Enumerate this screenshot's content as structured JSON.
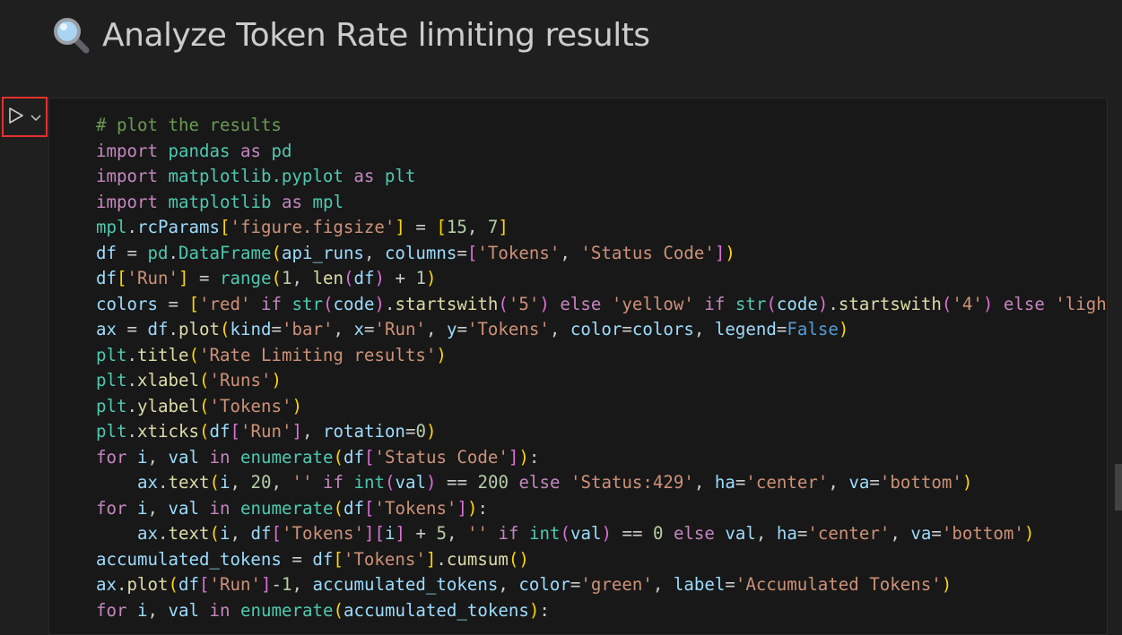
{
  "heading": {
    "icon": "magnifier-icon",
    "text": "Analyze Token Rate limiting results"
  },
  "cell_toolbar": {
    "run_icon": "run-triangle-icon",
    "menu_icon": "chevron-down-icon",
    "highlight_color": "#e5312d"
  },
  "theme": {
    "background": "#1f1f1f",
    "cell_background": "#181818",
    "comment": "#6a9955",
    "keyword": "#c586c0",
    "module": "#4ec9b0",
    "string": "#ce9178",
    "number": "#b5cea8",
    "function": "#dcdcaa",
    "variable": "#9cdcfe",
    "constant": "#569cd6",
    "bracket_1": "#ffd700",
    "bracket_2": "#da70d6",
    "bracket_3": "#179fff"
  },
  "code_lines": [
    {
      "indent": 0,
      "tokens": [
        [
          "cm",
          "# plot the results"
        ]
      ]
    },
    {
      "indent": 0,
      "tokens": [
        [
          "kw",
          "import"
        ],
        [
          "pl",
          " "
        ],
        [
          "md",
          "pandas"
        ],
        [
          "pl",
          " "
        ],
        [
          "kw",
          "as"
        ],
        [
          "pl",
          " "
        ],
        [
          "md",
          "pd"
        ]
      ]
    },
    {
      "indent": 0,
      "tokens": [
        [
          "kw",
          "import"
        ],
        [
          "pl",
          " "
        ],
        [
          "md",
          "matplotlib.pyplot"
        ],
        [
          "pl",
          " "
        ],
        [
          "kw",
          "as"
        ],
        [
          "pl",
          " "
        ],
        [
          "md",
          "plt"
        ]
      ]
    },
    {
      "indent": 0,
      "tokens": [
        [
          "kw",
          "import"
        ],
        [
          "pl",
          " "
        ],
        [
          "md",
          "matplotlib"
        ],
        [
          "pl",
          " "
        ],
        [
          "kw",
          "as"
        ],
        [
          "pl",
          " "
        ],
        [
          "md",
          "mpl"
        ]
      ]
    },
    {
      "indent": 0,
      "tokens": [
        [
          "md",
          "mpl"
        ],
        [
          "pl",
          "."
        ],
        [
          "vr",
          "rcParams"
        ],
        [
          "b1",
          "["
        ],
        [
          "st",
          "'figure.figsize'"
        ],
        [
          "b1",
          "]"
        ],
        [
          "pl",
          " = "
        ],
        [
          "b1",
          "["
        ],
        [
          "nm",
          "15"
        ],
        [
          "pl",
          ", "
        ],
        [
          "nm",
          "7"
        ],
        [
          "b1",
          "]"
        ]
      ]
    },
    {
      "indent": 0,
      "tokens": [
        [
          "vr",
          "df"
        ],
        [
          "pl",
          " = "
        ],
        [
          "md",
          "pd"
        ],
        [
          "pl",
          "."
        ],
        [
          "md",
          "DataFrame"
        ],
        [
          "b1",
          "("
        ],
        [
          "vr",
          "api_runs"
        ],
        [
          "pl",
          ", "
        ],
        [
          "vr",
          "columns"
        ],
        [
          "pl",
          "="
        ],
        [
          "b2",
          "["
        ],
        [
          "st",
          "'Tokens'"
        ],
        [
          "pl",
          ", "
        ],
        [
          "st",
          "'Status Code'"
        ],
        [
          "b2",
          "]"
        ],
        [
          "b1",
          ")"
        ]
      ]
    },
    {
      "indent": 0,
      "tokens": [
        [
          "vr",
          "df"
        ],
        [
          "b1",
          "["
        ],
        [
          "st",
          "'Run'"
        ],
        [
          "b1",
          "]"
        ],
        [
          "pl",
          " = "
        ],
        [
          "md",
          "range"
        ],
        [
          "b1",
          "("
        ],
        [
          "nm",
          "1"
        ],
        [
          "pl",
          ", "
        ],
        [
          "fn",
          "len"
        ],
        [
          "b2",
          "("
        ],
        [
          "vr",
          "df"
        ],
        [
          "b2",
          ")"
        ],
        [
          "pl",
          " + "
        ],
        [
          "nm",
          "1"
        ],
        [
          "b1",
          ")"
        ]
      ]
    },
    {
      "indent": 0,
      "tokens": [
        [
          "vr",
          "colors"
        ],
        [
          "pl",
          " = "
        ],
        [
          "b1",
          "["
        ],
        [
          "st",
          "'red'"
        ],
        [
          "pl",
          " "
        ],
        [
          "kw",
          "if"
        ],
        [
          "pl",
          " "
        ],
        [
          "md",
          "str"
        ],
        [
          "b2",
          "("
        ],
        [
          "vr",
          "code"
        ],
        [
          "b2",
          ")"
        ],
        [
          "pl",
          "."
        ],
        [
          "fn",
          "startswith"
        ],
        [
          "b2",
          "("
        ],
        [
          "st",
          "'5'"
        ],
        [
          "b2",
          ")"
        ],
        [
          "pl",
          " "
        ],
        [
          "kw",
          "else"
        ],
        [
          "pl",
          " "
        ],
        [
          "st",
          "'yellow'"
        ],
        [
          "pl",
          " "
        ],
        [
          "kw",
          "if"
        ],
        [
          "pl",
          " "
        ],
        [
          "md",
          "str"
        ],
        [
          "b2",
          "("
        ],
        [
          "vr",
          "code"
        ],
        [
          "b2",
          ")"
        ],
        [
          "pl",
          "."
        ],
        [
          "fn",
          "startswith"
        ],
        [
          "b2",
          "("
        ],
        [
          "st",
          "'4'"
        ],
        [
          "b2",
          ")"
        ],
        [
          "pl",
          " "
        ],
        [
          "kw",
          "else"
        ],
        [
          "pl",
          " "
        ],
        [
          "st",
          "'ligh"
        ]
      ]
    },
    {
      "indent": 0,
      "tokens": [
        [
          "vr",
          "ax"
        ],
        [
          "pl",
          " = "
        ],
        [
          "vr",
          "df"
        ],
        [
          "pl",
          "."
        ],
        [
          "fn",
          "plot"
        ],
        [
          "b1",
          "("
        ],
        [
          "vr",
          "kind"
        ],
        [
          "pl",
          "="
        ],
        [
          "st",
          "'bar'"
        ],
        [
          "pl",
          ", "
        ],
        [
          "vr",
          "x"
        ],
        [
          "pl",
          "="
        ],
        [
          "st",
          "'Run'"
        ],
        [
          "pl",
          ", "
        ],
        [
          "vr",
          "y"
        ],
        [
          "pl",
          "="
        ],
        [
          "st",
          "'Tokens'"
        ],
        [
          "pl",
          ", "
        ],
        [
          "vr",
          "color"
        ],
        [
          "pl",
          "="
        ],
        [
          "vr",
          "colors"
        ],
        [
          "pl",
          ", "
        ],
        [
          "vr",
          "legend"
        ],
        [
          "pl",
          "="
        ],
        [
          "bl",
          "False"
        ],
        [
          "b1",
          ")"
        ]
      ]
    },
    {
      "indent": 0,
      "tokens": [
        [
          "md",
          "plt"
        ],
        [
          "pl",
          "."
        ],
        [
          "fn",
          "title"
        ],
        [
          "b1",
          "("
        ],
        [
          "st",
          "'Rate Limiting results'"
        ],
        [
          "b1",
          ")"
        ]
      ]
    },
    {
      "indent": 0,
      "tokens": [
        [
          "md",
          "plt"
        ],
        [
          "pl",
          "."
        ],
        [
          "fn",
          "xlabel"
        ],
        [
          "b1",
          "("
        ],
        [
          "st",
          "'Runs'"
        ],
        [
          "b1",
          ")"
        ]
      ]
    },
    {
      "indent": 0,
      "tokens": [
        [
          "md",
          "plt"
        ],
        [
          "pl",
          "."
        ],
        [
          "fn",
          "ylabel"
        ],
        [
          "b1",
          "("
        ],
        [
          "st",
          "'Tokens'"
        ],
        [
          "b1",
          ")"
        ]
      ]
    },
    {
      "indent": 0,
      "tokens": [
        [
          "md",
          "plt"
        ],
        [
          "pl",
          "."
        ],
        [
          "fn",
          "xticks"
        ],
        [
          "b1",
          "("
        ],
        [
          "vr",
          "df"
        ],
        [
          "b2",
          "["
        ],
        [
          "st",
          "'Run'"
        ],
        [
          "b2",
          "]"
        ],
        [
          "pl",
          ", "
        ],
        [
          "vr",
          "rotation"
        ],
        [
          "pl",
          "="
        ],
        [
          "nm",
          "0"
        ],
        [
          "b1",
          ")"
        ]
      ]
    },
    {
      "indent": 0,
      "tokens": [
        [
          "kw",
          "for"
        ],
        [
          "pl",
          " "
        ],
        [
          "vr",
          "i"
        ],
        [
          "pl",
          ", "
        ],
        [
          "vr",
          "val"
        ],
        [
          "pl",
          " "
        ],
        [
          "kw",
          "in"
        ],
        [
          "pl",
          " "
        ],
        [
          "md",
          "enumerate"
        ],
        [
          "b1",
          "("
        ],
        [
          "vr",
          "df"
        ],
        [
          "b2",
          "["
        ],
        [
          "st",
          "'Status Code'"
        ],
        [
          "b2",
          "]"
        ],
        [
          "b1",
          ")"
        ],
        [
          "pl",
          ":"
        ]
      ]
    },
    {
      "indent": 1,
      "tokens": [
        [
          "vr",
          "ax"
        ],
        [
          "pl",
          "."
        ],
        [
          "fn",
          "text"
        ],
        [
          "b1",
          "("
        ],
        [
          "vr",
          "i"
        ],
        [
          "pl",
          ", "
        ],
        [
          "nm",
          "20"
        ],
        [
          "pl",
          ", "
        ],
        [
          "st",
          "''"
        ],
        [
          "pl",
          " "
        ],
        [
          "kw",
          "if"
        ],
        [
          "pl",
          " "
        ],
        [
          "md",
          "int"
        ],
        [
          "b2",
          "("
        ],
        [
          "vr",
          "val"
        ],
        [
          "b2",
          ")"
        ],
        [
          "pl",
          " == "
        ],
        [
          "nm",
          "200"
        ],
        [
          "pl",
          " "
        ],
        [
          "kw",
          "else"
        ],
        [
          "pl",
          " "
        ],
        [
          "st",
          "'Status:429'"
        ],
        [
          "pl",
          ", "
        ],
        [
          "vr",
          "ha"
        ],
        [
          "pl",
          "="
        ],
        [
          "st",
          "'center'"
        ],
        [
          "pl",
          ", "
        ],
        [
          "vr",
          "va"
        ],
        [
          "pl",
          "="
        ],
        [
          "st",
          "'bottom'"
        ],
        [
          "b1",
          ")"
        ]
      ]
    },
    {
      "indent": 0,
      "tokens": [
        [
          "kw",
          "for"
        ],
        [
          "pl",
          " "
        ],
        [
          "vr",
          "i"
        ],
        [
          "pl",
          ", "
        ],
        [
          "vr",
          "val"
        ],
        [
          "pl",
          " "
        ],
        [
          "kw",
          "in"
        ],
        [
          "pl",
          " "
        ],
        [
          "md",
          "enumerate"
        ],
        [
          "b1",
          "("
        ],
        [
          "vr",
          "df"
        ],
        [
          "b2",
          "["
        ],
        [
          "st",
          "'Tokens'"
        ],
        [
          "b2",
          "]"
        ],
        [
          "b1",
          ")"
        ],
        [
          "pl",
          ":"
        ]
      ]
    },
    {
      "indent": 1,
      "tokens": [
        [
          "vr",
          "ax"
        ],
        [
          "pl",
          "."
        ],
        [
          "fn",
          "text"
        ],
        [
          "b1",
          "("
        ],
        [
          "vr",
          "i"
        ],
        [
          "pl",
          ", "
        ],
        [
          "vr",
          "df"
        ],
        [
          "b2",
          "["
        ],
        [
          "st",
          "'Tokens'"
        ],
        [
          "b2",
          "]"
        ],
        [
          "b2",
          "["
        ],
        [
          "vr",
          "i"
        ],
        [
          "b2",
          "]"
        ],
        [
          "pl",
          " + "
        ],
        [
          "nm",
          "5"
        ],
        [
          "pl",
          ", "
        ],
        [
          "st",
          "''"
        ],
        [
          "pl",
          " "
        ],
        [
          "kw",
          "if"
        ],
        [
          "pl",
          " "
        ],
        [
          "md",
          "int"
        ],
        [
          "b2",
          "("
        ],
        [
          "vr",
          "val"
        ],
        [
          "b2",
          ")"
        ],
        [
          "pl",
          " == "
        ],
        [
          "nm",
          "0"
        ],
        [
          "pl",
          " "
        ],
        [
          "kw",
          "else"
        ],
        [
          "pl",
          " "
        ],
        [
          "vr",
          "val"
        ],
        [
          "pl",
          ", "
        ],
        [
          "vr",
          "ha"
        ],
        [
          "pl",
          "="
        ],
        [
          "st",
          "'center'"
        ],
        [
          "pl",
          ", "
        ],
        [
          "vr",
          "va"
        ],
        [
          "pl",
          "="
        ],
        [
          "st",
          "'bottom'"
        ],
        [
          "b1",
          ")"
        ]
      ]
    },
    {
      "indent": 0,
      "tokens": [
        [
          "vr",
          "accumulated_tokens"
        ],
        [
          "pl",
          " = "
        ],
        [
          "vr",
          "df"
        ],
        [
          "b1",
          "["
        ],
        [
          "st",
          "'Tokens'"
        ],
        [
          "b1",
          "]"
        ],
        [
          "pl",
          "."
        ],
        [
          "fn",
          "cumsum"
        ],
        [
          "b1",
          "("
        ],
        [
          "b1",
          ")"
        ]
      ]
    },
    {
      "indent": 0,
      "tokens": [
        [
          "vr",
          "ax"
        ],
        [
          "pl",
          "."
        ],
        [
          "fn",
          "plot"
        ],
        [
          "b1",
          "("
        ],
        [
          "vr",
          "df"
        ],
        [
          "b2",
          "["
        ],
        [
          "st",
          "'Run'"
        ],
        [
          "b2",
          "]"
        ],
        [
          "pl",
          "-"
        ],
        [
          "nm",
          "1"
        ],
        [
          "pl",
          ", "
        ],
        [
          "vr",
          "accumulated_tokens"
        ],
        [
          "pl",
          ", "
        ],
        [
          "vr",
          "color"
        ],
        [
          "pl",
          "="
        ],
        [
          "st",
          "'green'"
        ],
        [
          "pl",
          ", "
        ],
        [
          "vr",
          "label"
        ],
        [
          "pl",
          "="
        ],
        [
          "st",
          "'Accumulated Tokens'"
        ],
        [
          "b1",
          ")"
        ]
      ]
    },
    {
      "indent": 0,
      "tokens": [
        [
          "kw",
          "for"
        ],
        [
          "pl",
          " "
        ],
        [
          "vr",
          "i"
        ],
        [
          "pl",
          ", "
        ],
        [
          "vr",
          "val"
        ],
        [
          "pl",
          " "
        ],
        [
          "kw",
          "in"
        ],
        [
          "pl",
          " "
        ],
        [
          "md",
          "enumerate"
        ],
        [
          "b1",
          "("
        ],
        [
          "vr",
          "accumulated_tokens"
        ],
        [
          "b1",
          ")"
        ],
        [
          "pl",
          ":"
        ]
      ]
    }
  ]
}
